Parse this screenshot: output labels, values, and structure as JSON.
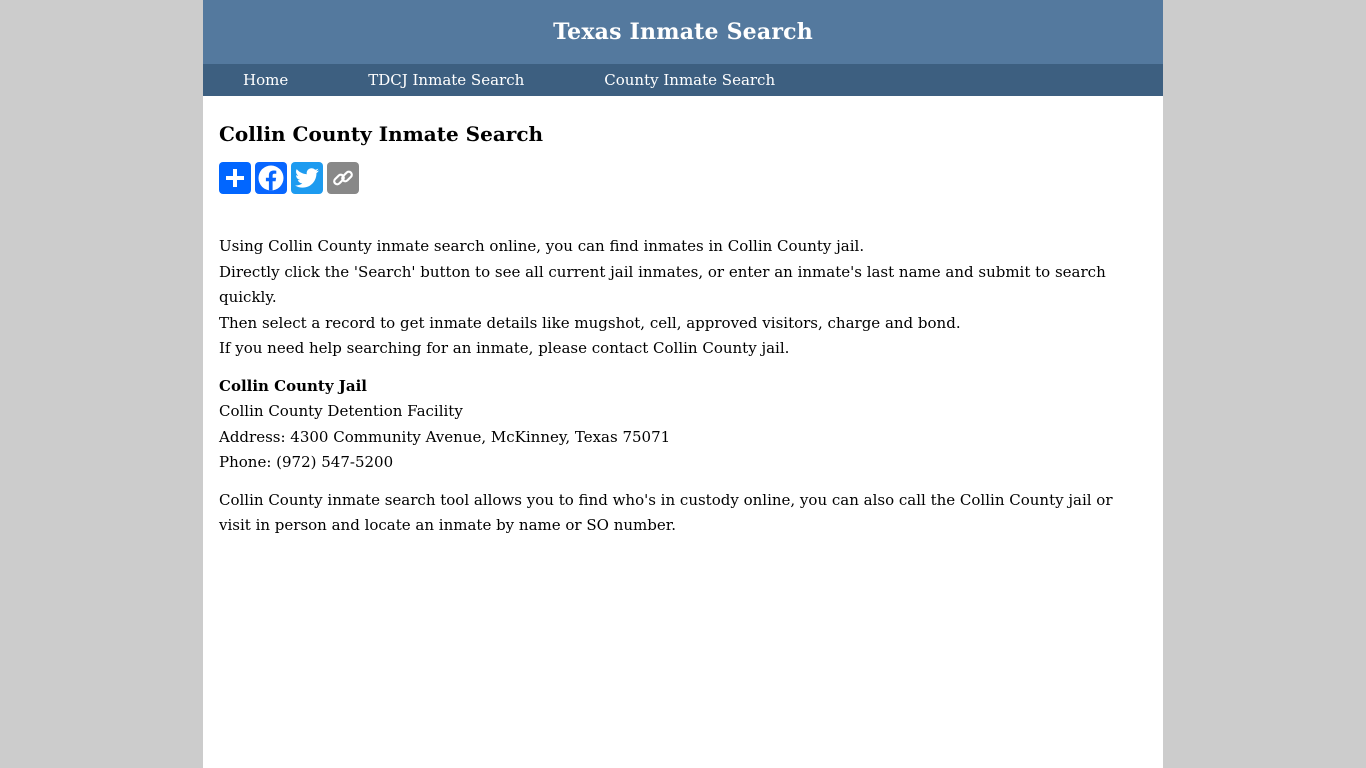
{
  "header": {
    "title": "Texas Inmate Search"
  },
  "nav": {
    "items": [
      {
        "label": "Home"
      },
      {
        "label": "TDCJ Inmate Search"
      },
      {
        "label": "County Inmate Search"
      }
    ]
  },
  "main": {
    "title": "Collin County Inmate Search",
    "share": {
      "buttons": [
        {
          "icon": "plus-icon",
          "color": "#0166ff"
        },
        {
          "icon": "facebook-icon",
          "color": "#0866ff"
        },
        {
          "icon": "twitter-icon",
          "color": "#1d9bf0"
        },
        {
          "icon": "link-icon",
          "color": "#888888"
        }
      ]
    },
    "intro": [
      "Using Collin County inmate search online, you can find inmates in Collin County jail.",
      "Directly click the 'Search' button to see all current jail inmates, or enter an inmate's last name and submit to search quickly.",
      "Then select a record to get inmate details like mugshot, cell, approved visitors, charge and bond.",
      "If you need help searching for an inmate, please contact Collin County jail."
    ],
    "jail": {
      "name": "Collin County Jail",
      "facility": "Collin County Detention Facility",
      "address": "Address: 4300 Community Avenue, McKinney, Texas 75071",
      "phone": "Phone: (972) 547-5200"
    },
    "outro": "Collin County inmate search tool allows you to find who's in custody online, you can also call the Collin County jail or visit in person and locate an inmate by name or SO number."
  },
  "colors": {
    "header_bg": "#54799e",
    "nav_bg": "#3d5f80",
    "page_bg": "#cccccc"
  }
}
